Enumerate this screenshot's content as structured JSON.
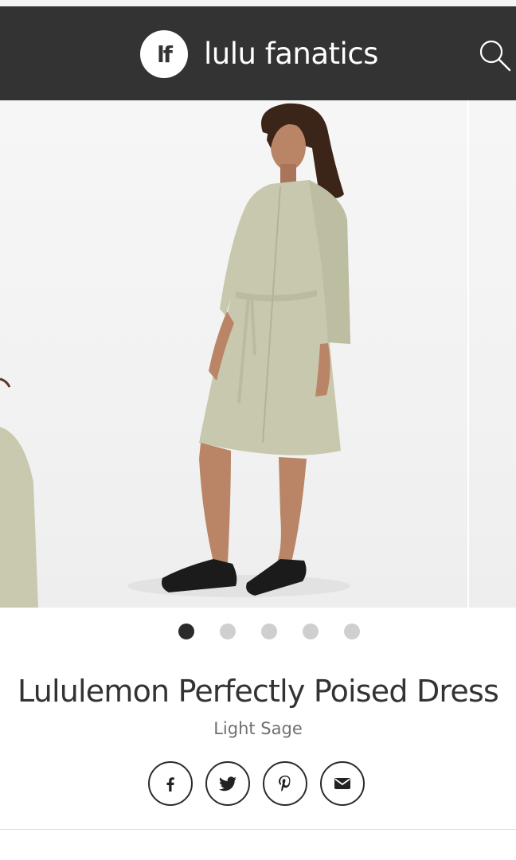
{
  "header": {
    "logo_text": "lf",
    "brand_name": "lulu fanatics",
    "search_icon": "search-icon",
    "background_color": "#333333"
  },
  "carousel": {
    "slide_count": 5,
    "active_index": 0,
    "image_description_icon": "product-photo"
  },
  "product": {
    "title": "Lululemon Perfectly Poised Dress",
    "color": "Light Sage"
  },
  "share": {
    "icons": [
      "facebook-icon",
      "twitter-icon",
      "pinterest-icon",
      "email-icon"
    ]
  }
}
